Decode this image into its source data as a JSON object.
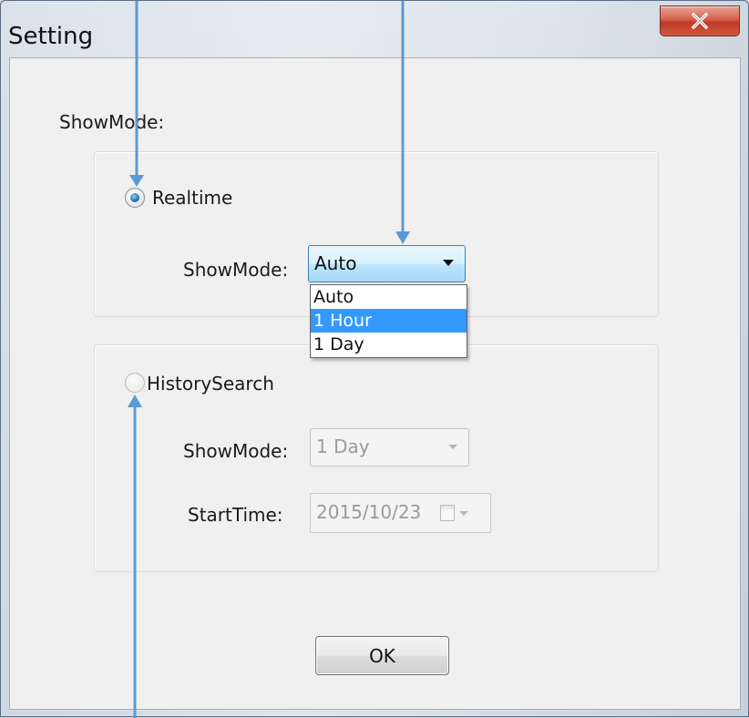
{
  "window": {
    "title": "Setting",
    "close_icon": "close-icon"
  },
  "show_mode_label": "ShowMode:",
  "realtime": {
    "label": "Realtime",
    "selected": true,
    "showmode_label": "ShowMode:",
    "showmode_value": "Auto",
    "dropdown_options": [
      "Auto",
      "1 Hour",
      "1 Day"
    ],
    "highlighted_option": "1 Hour"
  },
  "history": {
    "label": "HistorySearch",
    "selected": false,
    "showmode_label": "ShowMode:",
    "showmode_value": "1 Day",
    "starttime_label": "StartTime:",
    "starttime_value": "2015/10/23",
    "calendar_icon": "calendar-icon"
  },
  "buttons": {
    "ok": "OK"
  },
  "colors": {
    "annotation_arrow": "#5b9bd5",
    "selection": "#3399ff",
    "close_button": "#c94a35"
  }
}
